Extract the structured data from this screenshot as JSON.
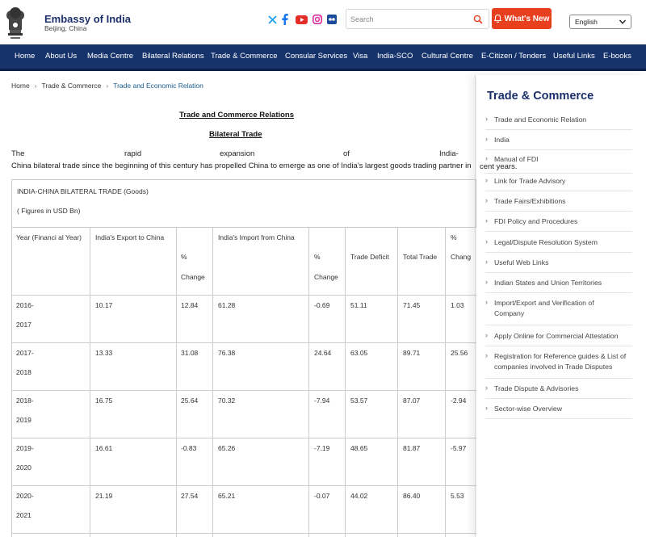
{
  "header": {
    "title": "Embassy of India",
    "subtitle": "Beijing, China",
    "search_placeholder": "Search",
    "whats_new": "What's New",
    "language": "English"
  },
  "social_icons": [
    "x-icon",
    "facebook-icon",
    "youtube-icon",
    "instagram-icon",
    "flickr-icon"
  ],
  "colors": {
    "nav": "#17336b",
    "brand": "#1c2f6b",
    "accent": "#e8401e",
    "link": "#1a5d8f"
  },
  "nav": [
    "Home",
    "About Us",
    "Media Centre",
    "Bilateral Relations",
    "Trade & Commerce",
    "Consular Services",
    "Visa",
    "India-SCO",
    "Cultural Centre",
    "E-Citizen / Tenders",
    "Useful Links",
    "E-books"
  ],
  "breadcrumb": [
    "Home",
    "Trade & Commerce",
    "Trade and Economic Relation"
  ],
  "content": {
    "heading": "Trade and Commerce Relations",
    "subheading": "Bilateral Trade",
    "para_words": [
      "The",
      "rapid",
      "expansion",
      "of",
      "India-"
    ],
    "para_line2": "China bilateral trade since the beginning of this century has propelled China to emerge as one of India's largest goods trading partner in"
  },
  "table": {
    "caption": "INDIA-CHINA BILATERAL TRADE (Goods)",
    "caption2": "( Figures in USD Bn)",
    "headers": {
      "year": "Year (Financi al Year)",
      "export": "India's Export to China",
      "pct1_a": "%",
      "pct1_b": "Change",
      "import": "India's Import from China",
      "pct2_a": "%",
      "pct2_b": "Change",
      "deficit": "Trade Deficit",
      "total": "Total Trade",
      "pct3_a": "%",
      "pct3_b": "Chang"
    },
    "rows": [
      {
        "y1": "2016-",
        "y2": "2017",
        "export": "10.17",
        "pct1": "12.84",
        "import": "61.28",
        "pct2": "-0.69",
        "deficit": "51.11",
        "total": "71.45",
        "pct3": "1.03"
      },
      {
        "y1": "2017-",
        "y2": "2018",
        "export": "13.33",
        "pct1": "31.08",
        "import": "76.38",
        "pct2": "24.64",
        "deficit": "63.05",
        "total": "89.71",
        "pct3": "25.56"
      },
      {
        "y1": "2018-",
        "y2": "2019",
        "export": "16.75",
        "pct1": "25.64",
        "import": "70.32",
        "pct2": "-7.94",
        "deficit": "53.57",
        "total": "87.07",
        "pct3": "-2.94"
      },
      {
        "y1": "2019-",
        "y2": "2020",
        "export": "16.61",
        "pct1": "-0.83",
        "import": "65.26",
        "pct2": "-7.19",
        "deficit": "48.65",
        "total": "81.87",
        "pct3": "-5.97"
      },
      {
        "y1": "2020-",
        "y2": "2021",
        "export": "21.19",
        "pct1": "27.54",
        "import": "65.21",
        "pct2": "-0.07",
        "deficit": "44.02",
        "total": "86.40",
        "pct3": "5.53"
      }
    ]
  },
  "sidebar": {
    "title": "Trade & Commerce",
    "overlap_text": "cent years.",
    "items": [
      {
        "label": "Trade and Economic Relation"
      },
      {
        "label": "India"
      },
      {
        "label": "Manual of FDI"
      },
      {
        "label": "Link for Trade Advisory"
      },
      {
        "label": "Trade Fairs/Exhibitions"
      },
      {
        "label": "FDI Policy and Procedures"
      },
      {
        "label": "Legal/Dispute Resolution System"
      },
      {
        "label": "Useful Web Links"
      },
      {
        "label": "Indian States and Union Territories"
      },
      {
        "label": "Import/Export and Verification of Company"
      },
      {
        "label": "Apply Online for Commercial Attestation"
      },
      {
        "label": "Registration for Reference guides & List of companies involved in Trade Disputes"
      },
      {
        "label": "Trade Dispute & Advisories"
      },
      {
        "label": "Sector-wise Overview"
      }
    ]
  }
}
